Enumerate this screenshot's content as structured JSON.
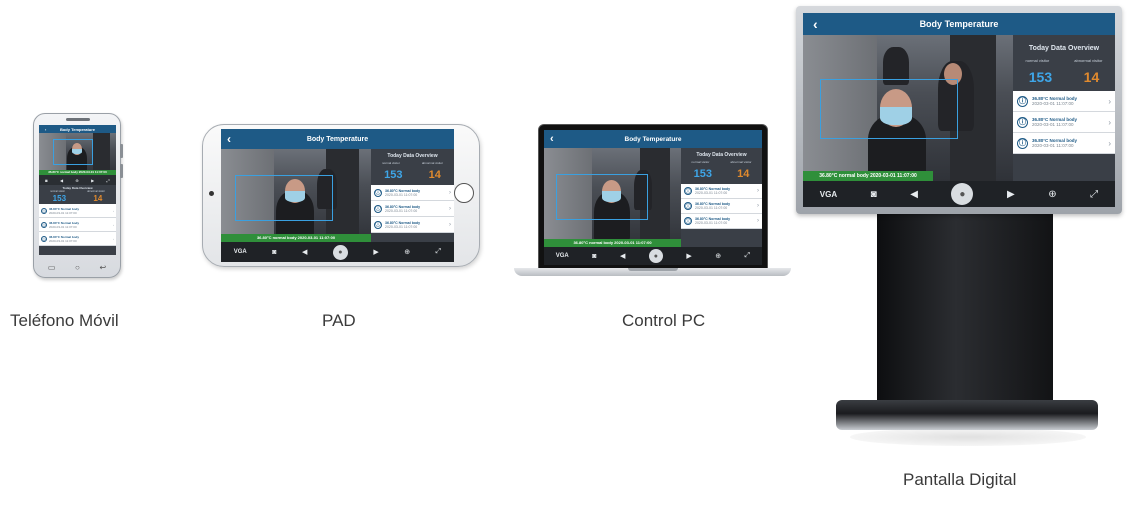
{
  "captions": {
    "phone": "Teléfono Móvil",
    "pad": "PAD",
    "pc": "Control PC",
    "display": "Pantalla Digital"
  },
  "app": {
    "title": "Body Temperature",
    "back_icon": "chevron-left-icon",
    "overview_title": "Today Data Overview",
    "normal_count": "153",
    "abnormal_count": "14",
    "normal_label": "normal visitor",
    "abnormal_label": "abnormal visitor",
    "record_text": "36.80°C Normal body",
    "record_time": "2020-03-01 11:07:00",
    "capture_stamp": "36.80°C normal body 2020-03-01 11:07:00",
    "toolbar": {
      "vga_label": "VGA",
      "icons": [
        "camera-icon",
        "speaker-icon",
        "microphone-icon",
        "video-record-icon",
        "zoom-icon",
        "fullscreen-icon"
      ]
    },
    "colors": {
      "header": "#1e5a86",
      "normal": "#3ea6e8",
      "abnormal": "#e08a2e",
      "stamp": "#2f8f3a"
    }
  }
}
